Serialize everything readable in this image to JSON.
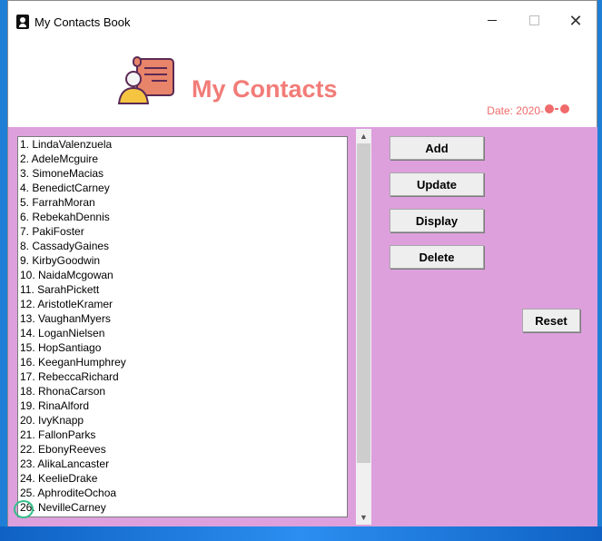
{
  "window": {
    "title": "My Contacts Book",
    "controls": {
      "minimize": "minimize-icon",
      "maximize": "maximize-icon",
      "close": "close-icon"
    }
  },
  "header": {
    "heading": "My Contacts",
    "date": "Date: 2020-",
    "logo": "contact-scroll-icon",
    "heading_color": "#f27c78"
  },
  "contacts": [
    "1. LindaValenzuela",
    "2. AdeleMcguire",
    "3. SimoneMacias",
    "4. BenedictCarney",
    "5. FarrahMoran",
    "6. RebekahDennis",
    "7. PakiFoster",
    "8. CassadyGaines",
    "9. KirbyGoodwin",
    "10. NaidaMcgowan",
    "11. SarahPickett",
    "12. AristotleKramer",
    "13. VaughanMyers",
    "14. LoganNielsen",
    "15. HopSantiago",
    "16. KeeganHumphrey",
    "17. RebeccaRichard",
    "18. RhonaCarson",
    "19. RinaAlford",
    "20. IvyKnapp",
    "21. FallonParks",
    "22. EbonyReeves",
    "23. AlikaLancaster",
    "24. KeelieDrake",
    "25. AphroditeOchoa",
    "26. NevilleCarney"
  ],
  "buttons": {
    "add": "Add",
    "update": "Update",
    "display": "Display",
    "delete": "Delete",
    "reset": "Reset"
  },
  "colors": {
    "panel": "#dda0dd",
    "desktop": "#1f7fd6"
  }
}
